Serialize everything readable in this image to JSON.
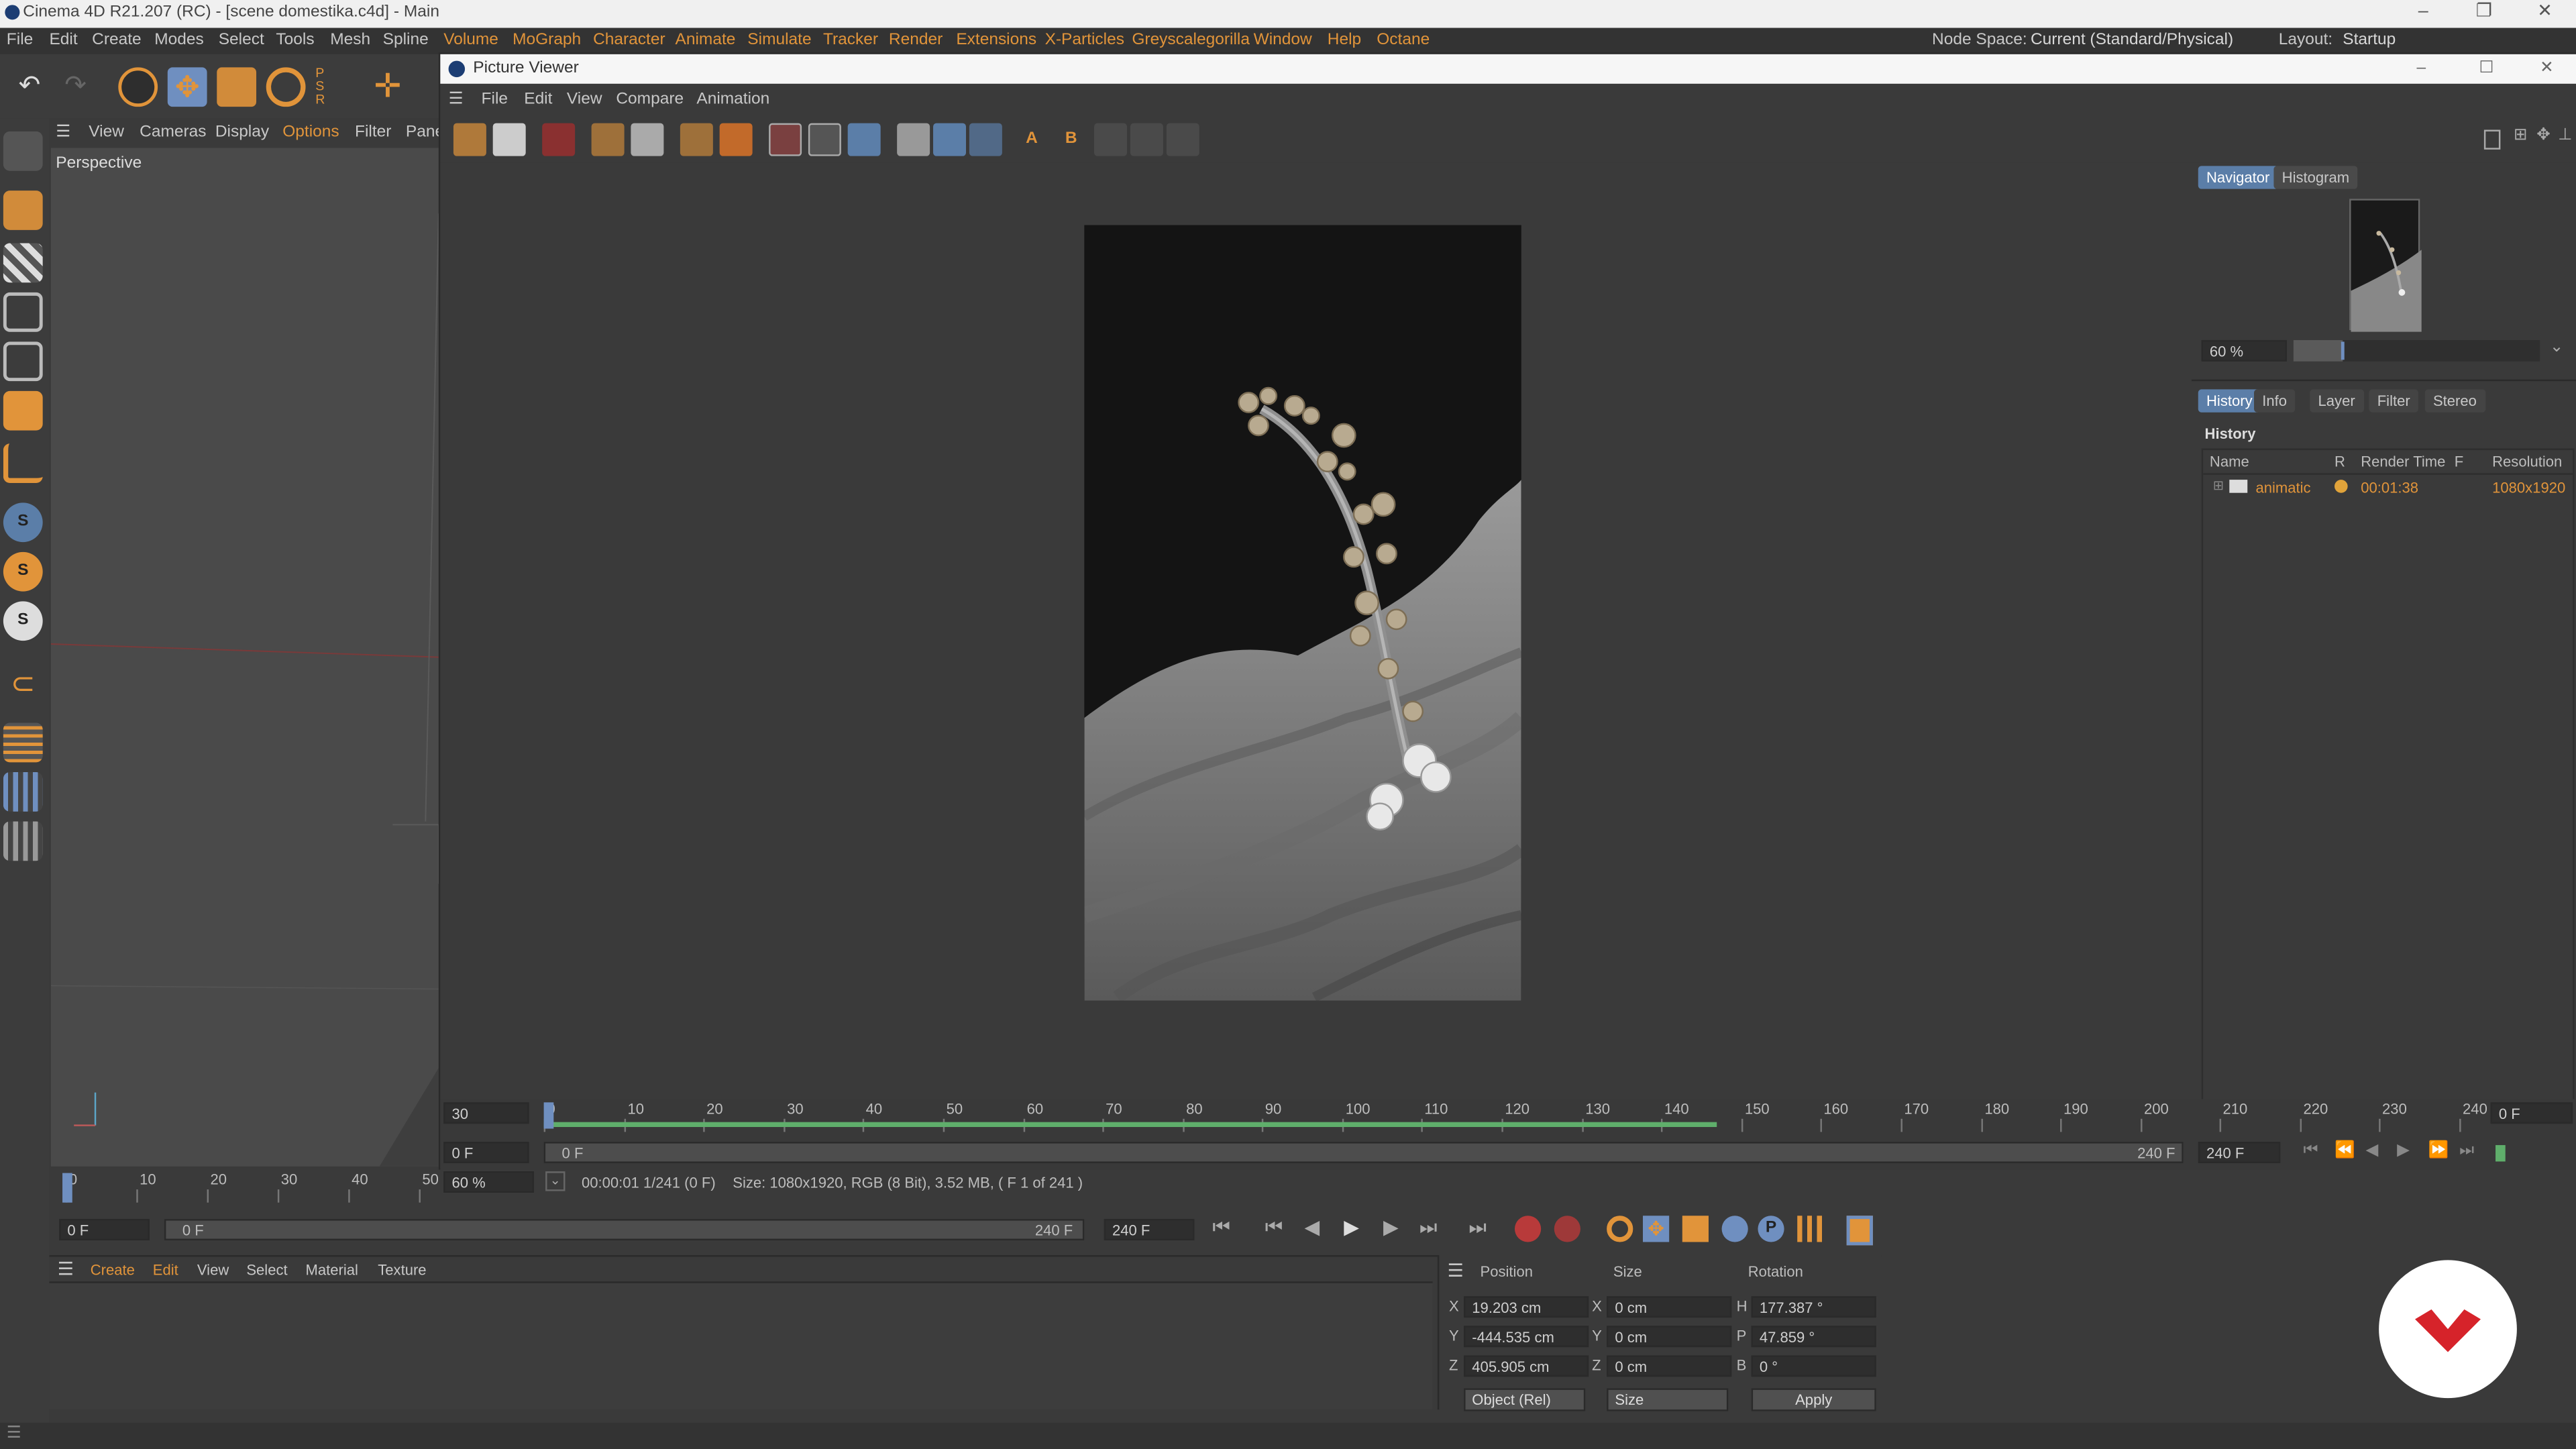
{
  "app": {
    "title": "Cinema 4D R21.207 (RC) - [scene domestika.c4d] - Main"
  },
  "menu": {
    "items": [
      "File",
      "Edit",
      "Create",
      "Modes",
      "Select",
      "Tools",
      "Mesh",
      "Spline",
      "Volume",
      "MoGraph",
      "Character",
      "Animate",
      "Simulate",
      "Tracker",
      "Render",
      "Extensions",
      "X-Particles",
      "Greyscalegorilla",
      "Window",
      "Help",
      "Octane"
    ],
    "node_space_label": "Node Space:",
    "node_space_value": "Current (Standard/Physical)",
    "layout_label": "Layout:",
    "layout_value": "Startup"
  },
  "viewport": {
    "menu": [
      "View",
      "Cameras",
      "Display",
      "Options",
      "Filter",
      "Pane"
    ],
    "title": "Perspective"
  },
  "picture_viewer": {
    "title": "Picture Viewer",
    "menu": [
      "File",
      "Edit",
      "View",
      "Compare",
      "Animation"
    ],
    "tabs_top": [
      "Navigator",
      "Histogram"
    ],
    "zoom": "60 %",
    "tabs_mid": [
      "History",
      "Info",
      "Layer",
      "Filter",
      "Stereo"
    ],
    "history_title": "History",
    "columns": [
      "Name",
      "R",
      "Render Time",
      "F",
      "Resolution"
    ],
    "row": {
      "name": "animatic",
      "render_time": "00:01:38",
      "resolution": "1080x1920"
    },
    "timeline_labels": [
      "0",
      "10",
      "20",
      "30",
      "40",
      "50",
      "60",
      "70",
      "80",
      "90",
      "100",
      "110",
      "120",
      "130",
      "140",
      "150",
      "160",
      "170",
      "180",
      "190",
      "200",
      "210",
      "220",
      "230",
      "240"
    ],
    "fps": "30",
    "start_frame": "0 F",
    "end_frame": "0 F",
    "bar_left": "0 F",
    "bar_right": "240 F",
    "end_field": "240 F",
    "current_field": "0 F",
    "status": "00:00:01 1/241 (0 F)",
    "status_size": "Size: 1080x1920, RGB (8 Bit), 3.52 MB,  ( F 1 of 241 )",
    "status_zoom": "60 %"
  },
  "main_timeline": {
    "labels": [
      "0",
      "10",
      "20",
      "30",
      "40",
      "50"
    ],
    "start": "0 F",
    "bar_left": "0 F",
    "bar_right": "240 F",
    "end": "240 F"
  },
  "material_menu": [
    "Create",
    "Edit",
    "View",
    "Select",
    "Material",
    "Texture"
  ],
  "coords": {
    "headers": [
      "Position",
      "Size",
      "Rotation"
    ],
    "rows": [
      {
        "axis": "X",
        "pos": "19.203 cm",
        "saxis": "X",
        "size": "0 cm",
        "raxis": "H",
        "rot": "177.387 °"
      },
      {
        "axis": "Y",
        "pos": "-444.535 cm",
        "saxis": "Y",
        "size": "0 cm",
        "raxis": "P",
        "rot": "47.859 °"
      },
      {
        "axis": "Z",
        "pos": "405.905 cm",
        "saxis": "Z",
        "size": "0 cm",
        "raxis": "B",
        "rot": "0 °"
      }
    ],
    "mode": "Object (Rel)",
    "size_mode": "Size",
    "apply": "Apply"
  },
  "colors": {
    "accent": "#e1943a",
    "tab_active": "#5b7ea8",
    "progress": "#5fae6b",
    "brand": "#d6232a"
  }
}
